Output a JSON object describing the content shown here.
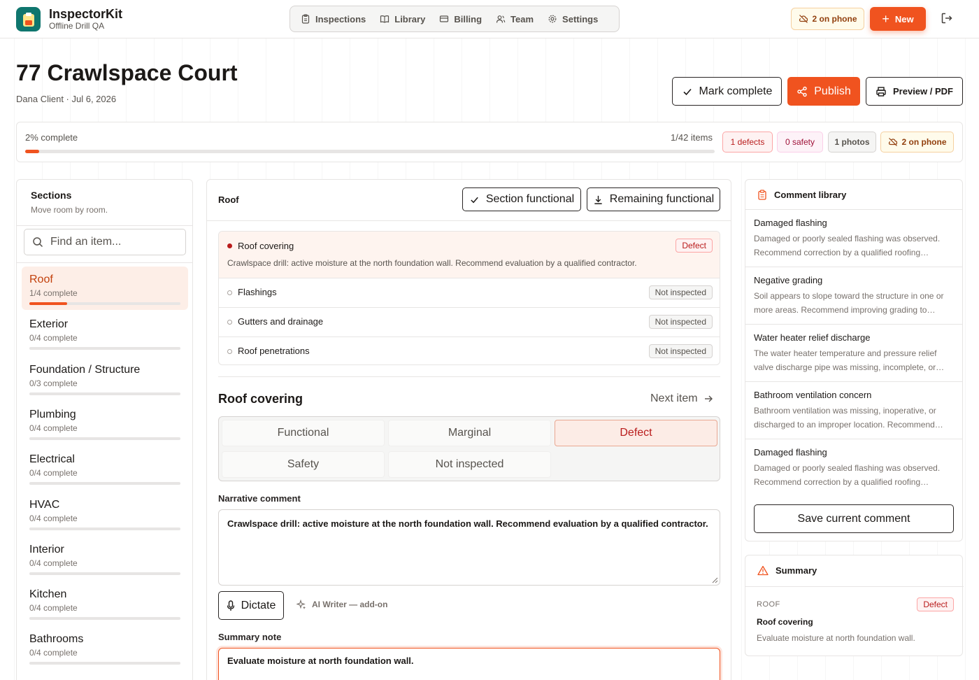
{
  "app": {
    "name": "InspectorKit",
    "subtitle": "Offline Drill QA"
  },
  "nav": [
    {
      "label": "Inspections",
      "icon": "clipboard-icon"
    },
    {
      "label": "Library",
      "icon": "book-icon"
    },
    {
      "label": "Billing",
      "icon": "credit-card-icon"
    },
    {
      "label": "Team",
      "icon": "users-icon"
    },
    {
      "label": "Settings",
      "icon": "gear-icon"
    }
  ],
  "header": {
    "phone_label": "2 on phone",
    "new_label": "New"
  },
  "page": {
    "title": "77 Crawlspace Court",
    "meta": "Dana Client · Jul 6, 2026",
    "actions": {
      "mark_complete": "Mark complete",
      "publish": "Publish",
      "preview": "Preview / PDF"
    }
  },
  "progress": {
    "label": "2% complete",
    "fraction": 0.02,
    "items": "1/42 items",
    "badges": {
      "defects": "1 defects",
      "safety": "0 safety",
      "photos": "1 photos",
      "phone": "2 on phone"
    }
  },
  "sections": {
    "heading": "Sections",
    "sub": "Move room by room.",
    "search_placeholder": "Find an item...",
    "items": [
      {
        "name": "Roof",
        "count": "1/4 complete",
        "fraction": 0.25
      },
      {
        "name": "Exterior",
        "count": "0/4 complete",
        "fraction": 0
      },
      {
        "name": "Foundation / Structure",
        "count": "0/3 complete",
        "fraction": 0
      },
      {
        "name": "Plumbing",
        "count": "0/4 complete",
        "fraction": 0
      },
      {
        "name": "Electrical",
        "count": "0/4 complete",
        "fraction": 0
      },
      {
        "name": "HVAC",
        "count": "0/4 complete",
        "fraction": 0
      },
      {
        "name": "Interior",
        "count": "0/4 complete",
        "fraction": 0
      },
      {
        "name": "Kitchen",
        "count": "0/4 complete",
        "fraction": 0
      },
      {
        "name": "Bathrooms",
        "count": "0/4 complete",
        "fraction": 0
      }
    ]
  },
  "center": {
    "section_name": "Roof",
    "section_functional": "Section functional",
    "remaining_functional": "Remaining functional",
    "items": [
      {
        "name": "Roof covering",
        "status": "Defect",
        "note": "Crawlspace drill: active moisture at the north foundation wall. Recommend evaluation by a qualified contractor."
      },
      {
        "name": "Flashings",
        "status": "Not inspected"
      },
      {
        "name": "Gutters and drainage",
        "status": "Not inspected"
      },
      {
        "name": "Roof penetrations",
        "status": "Not inspected"
      }
    ],
    "detail_title": "Roof covering",
    "next_item": "Next item",
    "ratings": [
      "Functional",
      "Marginal",
      "Defect",
      "Safety",
      "Not inspected"
    ],
    "selected_rating": "Defect",
    "narrative_label": "Narrative comment",
    "narrative_value": "Crawlspace drill: active moisture at the north foundation wall. Recommend evaluation by a qualified contractor.",
    "dictate": "Dictate",
    "ai_writer": "AI Writer — add-on",
    "summary_label": "Summary note",
    "summary_value": "Evaluate moisture at north foundation wall."
  },
  "library": {
    "heading": "Comment library",
    "entries": [
      {
        "title": "Damaged flashing",
        "body": "Damaged or poorly sealed flashing was observed. Recommend correction by a qualified roofing…"
      },
      {
        "title": "Negative grading",
        "body": "Soil appears to slope toward the structure in one or more areas. Recommend improving grading to…"
      },
      {
        "title": "Water heater relief discharge",
        "body": "The water heater temperature and pressure relief valve discharge pipe was missing, incomplete, or…"
      },
      {
        "title": "Bathroom ventilation concern",
        "body": "Bathroom ventilation was missing, inoperative, or discharged to an improper location. Recommend…"
      },
      {
        "title": "Damaged flashing",
        "body": "Damaged or poorly sealed flashing was observed. Recommend correction by a qualified roofing…"
      }
    ],
    "save_label": "Save current comment"
  },
  "summary": {
    "heading": "Summary",
    "section": "ROOF",
    "status": "Defect",
    "item": "Roof covering",
    "note": "Evaluate moisture at north foundation wall."
  },
  "colors": {
    "accent": "#f0531f",
    "brand": "#0f766e",
    "defect": "#b91c1c"
  }
}
